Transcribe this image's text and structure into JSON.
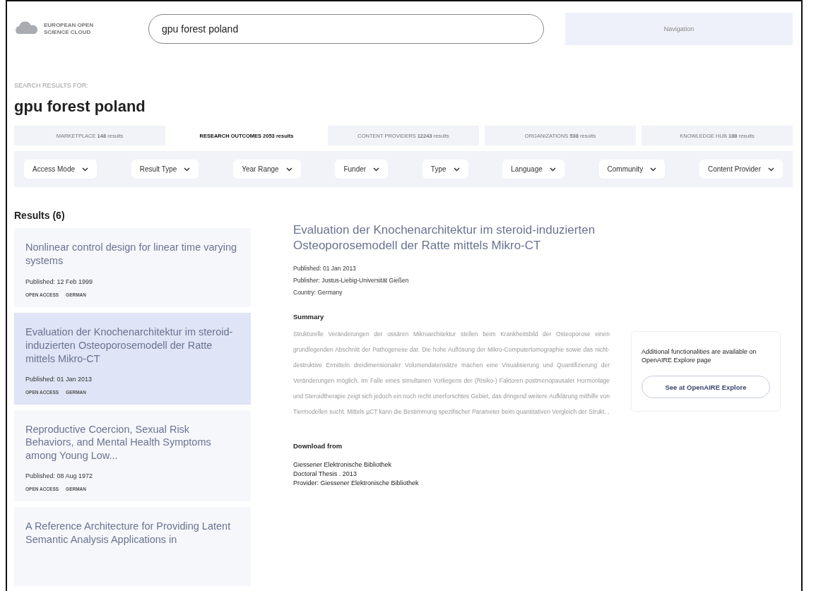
{
  "header": {
    "logo_text": "EUROPEAN OPEN SCIENCE CLOUD",
    "search": {
      "value": "gpu forest poland"
    },
    "navigation": "Navigation"
  },
  "search_label": "SEARCH RESULTS FOR:",
  "query_heading": "gpu forest poland",
  "tabs": [
    {
      "label": "MARKETPLACE **148** results",
      "selected": false
    },
    {
      "label": "RESEARCH OUTCOMES **2053** results",
      "selected": true
    },
    {
      "label": "CONTENT PROVIDERS **12243** results",
      "selected": false
    },
    {
      "label": "ORGANIZATIONS **538** results",
      "selected": false
    },
    {
      "label": "KNOWLEDGE HUB **188** results",
      "selected": false
    }
  ],
  "filters": [
    "Access Mode",
    "Result Type",
    "Year Range",
    "Funder",
    "Type",
    "Language",
    "Community",
    "Content Provider"
  ],
  "results": {
    "heading": "Results (6)",
    "items": [
      {
        "title": "Nonlinear control design for linear time varying systems",
        "published": "Published: 12 Feb 1999",
        "tags": [
          "OPEN ACCESS",
          "GERMAN"
        ],
        "selected": false
      },
      {
        "title": "Evaluation der Knochenarchitektur im steroid-induzierten Osteoporosemodell der Ratte mittels Mikro-CT",
        "published": "Published: 01 Jan 2013",
        "tags": [
          "OPEN ACCESS",
          "GERMAN"
        ],
        "selected": true
      },
      {
        "title": "Reproductive Coercion, Sexual Risk Behaviors, and Mental Health Symptoms among Young Low...",
        "published": "Published: 08 Aug 1972",
        "tags": [
          "OPEN ACCESS",
          "GERMAN"
        ],
        "selected": false
      },
      {
        "title": "A Reference Architecture for Providing Latent Semantic Analysis Applications in",
        "selected": false
      }
    ]
  },
  "detail": {
    "title": "Evaluation der Knochenarchitektur im steroid-induzierten Osteoporosemodell der Ratte mittels Mikro-CT",
    "meta": [
      "Published: 01 Jan 2013",
      "Publisher: Justus-Liebig-Universität Gießen",
      "Country: Germany"
    ],
    "summary_heading": "Summary",
    "summary": "Strukturelle Veränderungen der ossären Mikroarchitektur stellen beim Krankheitsbild der Osteoporose einen grundlegenden Abschnitt der Pathogenese dar. Die hohe Auflösung der Mikro-Computertomographie sowie das nicht-destruktive Ermitteln dreidimensionaler Volumendatensätze machen eine Visualisierung und Quantifizierung der Veränderungen möglich. Im Falle eines simultanen Vorliegens der (Risiko-) Faktoren postmenopausaler Hormonlage und Steroidtherapie zeigt sich jedoch ein noch recht unerforschtes Gebiet, das dringend weitere Aufklärung mithilfe von Tiermodellen sucht. Mittels µCT kann die Bestimmung spezifischer Parameter beim quantitativen Vergleich der Strukt...",
    "download_heading": "Download from",
    "download_lines": [
      "Giessener Elektronische Bibliothek",
      "Doctoral Thesis . 2013",
      "Provider: Giessener Elektronische Bibliothek"
    ],
    "side_box": {
      "text": "Additional functionalities are available on OpenAIRE Explore page",
      "button": "See at OpenAIRE Explore"
    }
  }
}
